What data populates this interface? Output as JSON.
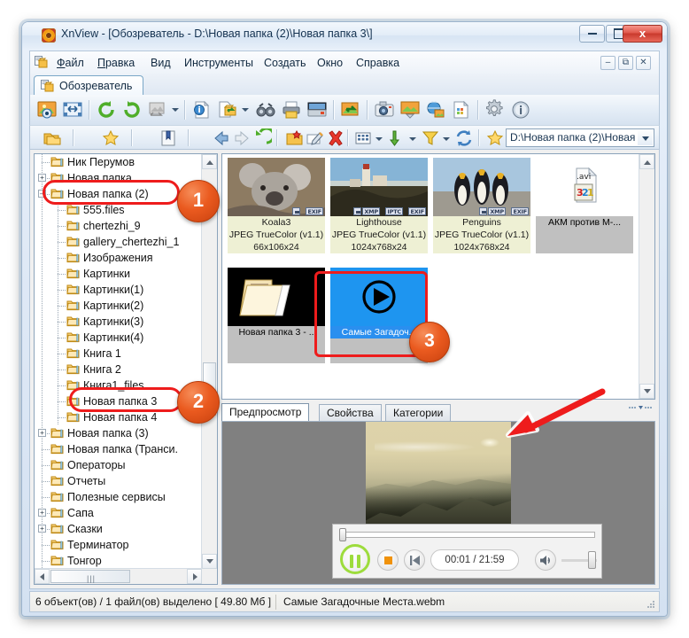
{
  "window": {
    "title": "XnView - [Обозреватель - D:\\Новая папка (2)\\Новая папка 3\\]",
    "app_icon": "xnview-icon",
    "minimize": "–",
    "maximize": "□",
    "close": "x"
  },
  "menubar": {
    "items": [
      "Файл",
      "Правка",
      "Вид",
      "Инструменты",
      "Создать",
      "Окно",
      "Справка"
    ],
    "mdi": {
      "minimize": "–",
      "restore": "⧉",
      "close": "✕"
    }
  },
  "tabs": {
    "browser": "Обозреватель"
  },
  "toolbar_main": {
    "icons": [
      "view-image-icon",
      "fit-window-icon",
      "rotate-left-icon",
      "rotate-right-icon",
      "batch-convert-icon",
      "info-icon",
      "copy-to-folder-icon",
      "find-icon",
      "print-icon",
      "scan-icon",
      "export-icon",
      "screen-capture-icon",
      "slideshow-icon",
      "web-page-icon",
      "contact-sheet-icon",
      "settings-icon",
      "about-icon"
    ]
  },
  "toolbar_nav": {
    "icons": [
      "folder-view-icon",
      "favorites-icon",
      "bookmark-icon",
      "back-icon",
      "forward-icon",
      "up-icon",
      "new-folder-icon",
      "rename-icon",
      "delete-icon",
      "thumbnail-mode-icon",
      "sort-icon",
      "filter-icon",
      "refresh-icon",
      "add-favorite-icon"
    ],
    "address_value": "D:\\Новая папка (2)\\Новая"
  },
  "tree": {
    "items": [
      {
        "label": "Ник Перумов",
        "indent": 2,
        "expander": "none",
        "dim": false
      },
      {
        "label": "Новая папка",
        "indent": 2,
        "expander": "plus",
        "dim": false
      },
      {
        "label": "Новая папка (2)",
        "indent": 2,
        "expander": "minus",
        "dim": false
      },
      {
        "label": "555.files",
        "indent": 3,
        "expander": "none",
        "dim": true
      },
      {
        "label": "chertezhi_9",
        "indent": 3,
        "expander": "none",
        "dim": false
      },
      {
        "label": "gallery_chertezhi_1",
        "indent": 3,
        "expander": "none",
        "dim": false
      },
      {
        "label": "Изображения",
        "indent": 3,
        "expander": "none",
        "dim": false
      },
      {
        "label": "Картинки",
        "indent": 3,
        "expander": "none",
        "dim": false
      },
      {
        "label": "Картинки(1)",
        "indent": 3,
        "expander": "none",
        "dim": false
      },
      {
        "label": "Картинки(2)",
        "indent": 3,
        "expander": "none",
        "dim": false
      },
      {
        "label": "Картинки(3)",
        "indent": 3,
        "expander": "none",
        "dim": false
      },
      {
        "label": "Картинки(4)",
        "indent": 3,
        "expander": "none",
        "dim": false
      },
      {
        "label": "Книга 1",
        "indent": 3,
        "expander": "none",
        "dim": false
      },
      {
        "label": "Книга 2",
        "indent": 3,
        "expander": "none",
        "dim": false
      },
      {
        "label": "Книга1_files",
        "indent": 3,
        "expander": "none",
        "dim": true
      },
      {
        "label": "Новая папка 3",
        "indent": 3,
        "expander": "none",
        "dim": false
      },
      {
        "label": "Новая папка 4",
        "indent": 3,
        "expander": "none",
        "dim": true
      },
      {
        "label": "Новая папка (3)",
        "indent": 2,
        "expander": "plus",
        "dim": false
      },
      {
        "label": "Новая папка (Транси.",
        "indent": 2,
        "expander": "none",
        "dim": false
      },
      {
        "label": "Операторы",
        "indent": 2,
        "expander": "none",
        "dim": false
      },
      {
        "label": "Отчеты",
        "indent": 2,
        "expander": "none",
        "dim": false
      },
      {
        "label": "Полезные сервисы",
        "indent": 2,
        "expander": "none",
        "dim": false
      },
      {
        "label": "Сапа",
        "indent": 2,
        "expander": "plus",
        "dim": false
      },
      {
        "label": "Сказки",
        "indent": 2,
        "expander": "plus",
        "dim": false
      },
      {
        "label": "Терминатор",
        "indent": 2,
        "expander": "none",
        "dim": false
      },
      {
        "label": "Тонгор",
        "indent": 2,
        "expander": "none",
        "dim": false
      }
    ]
  },
  "browser": {
    "thumbnails": [
      {
        "name": "Koala3",
        "line2": "JPEG TrueColor (v1.1)",
        "line3": "66x106x24",
        "badges": [
          "EXIF"
        ],
        "kind": "image-koala",
        "selected": false,
        "gray": false
      },
      {
        "name": "Lighthouse",
        "line2": "JPEG TrueColor (v1.1)",
        "line3": "1024x768x24",
        "badges": [
          "XMP",
          "IPTC",
          "EXIF"
        ],
        "kind": "image-lighthouse",
        "selected": false,
        "gray": false
      },
      {
        "name": "Penguins",
        "line2": "JPEG TrueColor (v1.1)",
        "line3": "1024x768x24",
        "badges": [
          "XMP",
          "EXIF"
        ],
        "kind": "image-penguins",
        "selected": false,
        "gray": false
      },
      {
        "name": "АКМ против М-...",
        "line2": "",
        "line3": "",
        "badges": [],
        "kind": "avi-file-icon",
        "selected": false,
        "gray": true
      },
      {
        "name": "Новая папка 3 - ..",
        "line2": "",
        "line3": "",
        "badges": [],
        "kind": "folder-thumb",
        "selected": false,
        "gray": true
      },
      {
        "name": "Самые Загадоч...",
        "line2": "",
        "line3": "",
        "badges": [],
        "kind": "video-play-icon",
        "selected": true,
        "gray": true
      }
    ],
    "avi_label": ".avi"
  },
  "preview": {
    "tabs": [
      "Предпросмотр",
      "Свойства",
      "Категории"
    ],
    "active_tab": "Предпросмотр",
    "image_name": "mountain-landscape-preview"
  },
  "player": {
    "pause_icon": "pause-icon",
    "stop_icon": "stop-icon",
    "prev_icon": "previous-icon",
    "time": "00:01 / 21:59",
    "volume_icon": "volume-icon",
    "seek_position_pct": 1,
    "volume_position_pct": 95
  },
  "statusbar": {
    "left": "6 объект(ов) / 1 файл(ов) выделено  [ 49.80 Мб ]",
    "right": "Самые Загадочные Места.webm"
  },
  "annotations": {
    "callouts": [
      {
        "number": "1",
        "target": "tree-item-novaya-papka-2"
      },
      {
        "number": "2",
        "target": "tree-item-novaya-papka-3"
      },
      {
        "number": "3",
        "target": "thumbnail-samye-zagadochnye"
      }
    ],
    "arrow": {
      "color": "#ee1c1c",
      "points_to": "preview-image"
    },
    "highlight_color": "#ee1c1c"
  }
}
